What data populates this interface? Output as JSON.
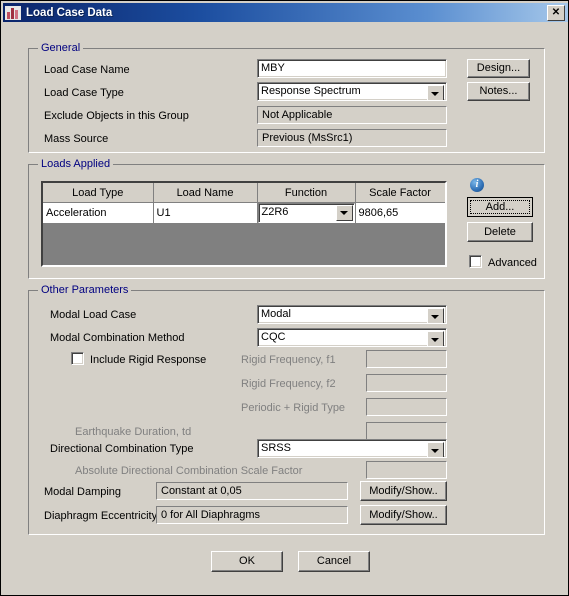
{
  "window": {
    "title": "Load Case Data",
    "close_label": "✕",
    "app_icon": "building-icon"
  },
  "general": {
    "legend": "General",
    "rows": [
      {
        "label": "Load Case Name",
        "value": "MBY",
        "type": "textbox"
      },
      {
        "label": "Load Case Type",
        "value": "Response Spectrum",
        "type": "combo"
      },
      {
        "label": "Exclude Objects in this Group",
        "value": "Not Applicable",
        "type": "readonly"
      },
      {
        "label": "Mass Source",
        "value": "Previous  (MsSrc1)",
        "type": "readonly"
      }
    ],
    "design_button": "Design...",
    "notes_button": "Notes..."
  },
  "loads_applied": {
    "legend": "Loads Applied",
    "columns": [
      "Load Type",
      "Load Name",
      "Function",
      "Scale Factor"
    ],
    "rows": [
      {
        "load_type": "Acceleration",
        "load_name": "U1",
        "function": "Z2R6",
        "scale_factor": "9806,65"
      }
    ],
    "info_icon": "info-icon",
    "add_button": "Add...",
    "delete_button": "Delete",
    "advanced_checkbox": {
      "label": "Advanced",
      "checked": false
    }
  },
  "other_parameters": {
    "legend": "Other Parameters",
    "modal_load_case": {
      "label": "Modal Load Case",
      "value": "Modal"
    },
    "modal_combination_method": {
      "label": "Modal Combination Method",
      "value": "CQC"
    },
    "include_rigid_response": {
      "label": "Include Rigid Response",
      "checked": false
    },
    "rigid_frequency_f1": {
      "label": "Rigid Frequency, f1",
      "value": ""
    },
    "rigid_frequency_f2": {
      "label": "Rigid Frequency, f2",
      "value": ""
    },
    "periodic_rigid_type": {
      "label": "Periodic + Rigid Type",
      "value": ""
    },
    "earthquake_duration": {
      "label": "Earthquake Duration, td",
      "value": ""
    },
    "directional_combination_type": {
      "label": "Directional Combination Type",
      "value": "SRSS"
    },
    "absolute_directional_scale_factor": {
      "label": "Absolute Directional Combination Scale Factor",
      "value": ""
    },
    "modal_damping": {
      "label": "Modal Damping",
      "value": "Constant at 0,05",
      "button": "Modify/Show.."
    },
    "diaphragm_eccentricity": {
      "label": "Diaphragm Eccentricity",
      "value": "0 for All Diaphragms",
      "button": "Modify/Show.."
    }
  },
  "footer": {
    "ok_button": "OK",
    "cancel_button": "Cancel"
  },
  "colors": {
    "dialog_face": "#d4d0c8",
    "title_gradient_start": "#0a246a",
    "title_gradient_end": "#a6c8ea",
    "legend_text": "#000080",
    "disabled_text": "#808080",
    "table_empty": "#808080"
  }
}
